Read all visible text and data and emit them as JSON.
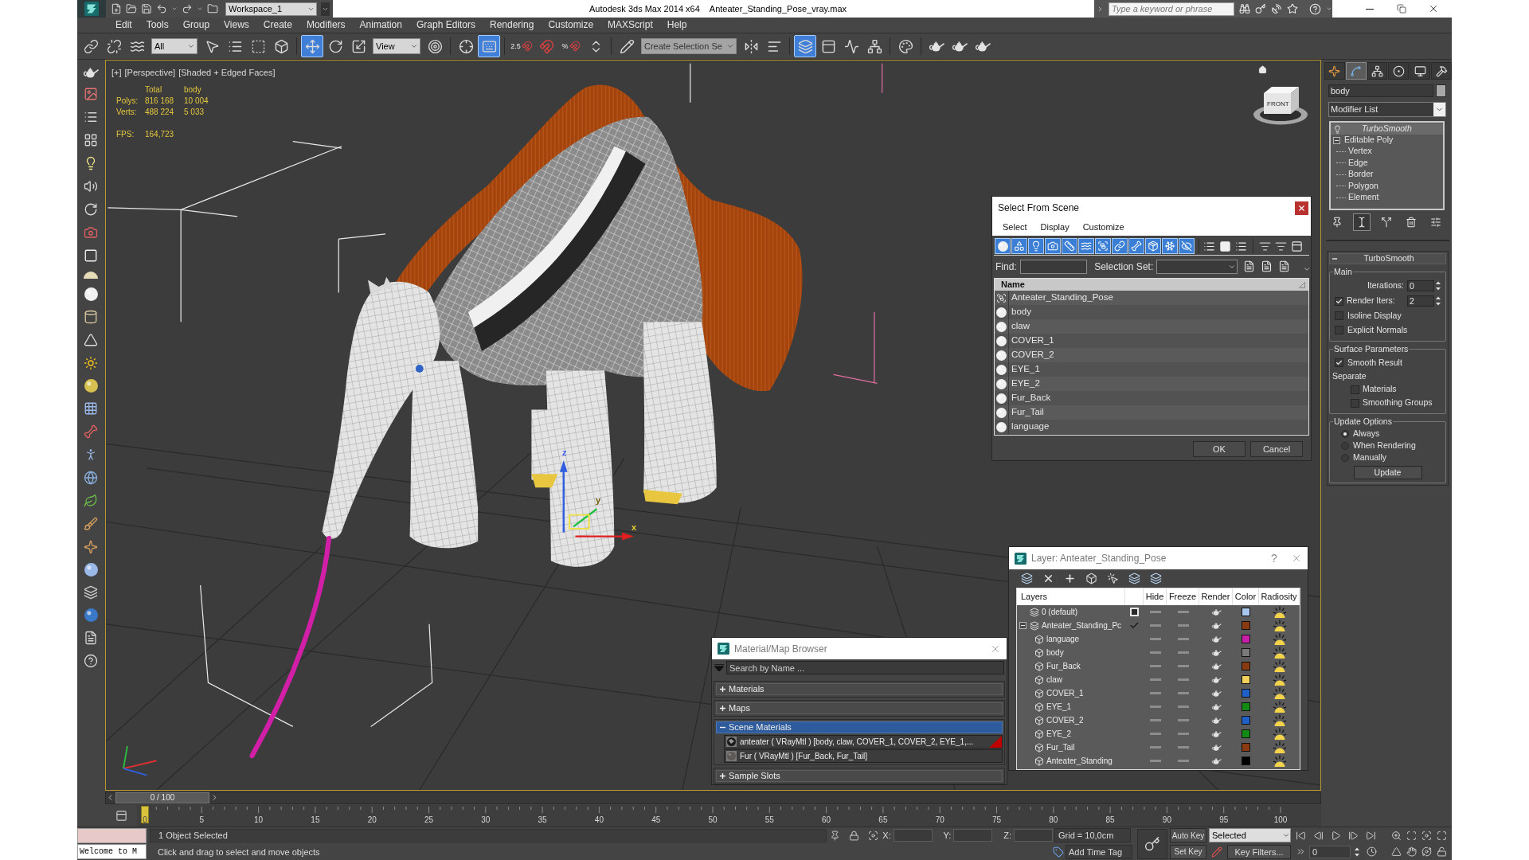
{
  "title_bar": {
    "workspace": "Workspace_1",
    "app_title": "Autodesk 3ds Max 2014 x64",
    "file_name": "Anteater_Standing_Pose_vray.max",
    "search": {
      "placeholder": "Type a keyword or phrase"
    }
  },
  "menu": [
    "Edit",
    "Tools",
    "Group",
    "Views",
    "Create",
    "Modifiers",
    "Animation",
    "Graph Editors",
    "Rendering",
    "Customize",
    "MAXScript",
    "Help"
  ],
  "main_toolbar": [
    {
      "kind": "link",
      "active": false
    },
    {
      "kind": "unlink",
      "active": false
    },
    {
      "kind": "bind",
      "active": false
    },
    {
      "kind": "filter",
      "value": "All"
    },
    {
      "kind": "select",
      "active": false
    },
    {
      "kind": "select_by_name",
      "active": false
    },
    {
      "kind": "region",
      "active": false
    },
    {
      "kind": "crossing",
      "active": false
    },
    {
      "kind": "move",
      "active": true
    },
    {
      "kind": "rotate",
      "active": false
    },
    {
      "kind": "scale",
      "active": false
    },
    {
      "kind": "coordinates",
      "value": "View"
    },
    {
      "kind": "pivot",
      "active": false
    },
    {
      "kind": "manipulate",
      "active": false
    },
    {
      "kind": "shortcut_override",
      "active": true
    },
    {
      "kind": "snap",
      "active": false,
      "label": "2.5"
    },
    {
      "kind": "angle_snap",
      "active": false
    },
    {
      "kind": "percent_snap",
      "active": false,
      "label": "%"
    },
    {
      "kind": "spinner_snap",
      "active": false
    },
    {
      "kind": "named_sets",
      "active": false
    },
    {
      "kind": "selection_sets",
      "value": "Create Selection Se"
    },
    {
      "kind": "mirror",
      "active": false
    },
    {
      "kind": "align",
      "active": false
    },
    {
      "kind": "layers",
      "active": true
    },
    {
      "kind": "ribbon",
      "active": false
    },
    {
      "kind": "curve_editor",
      "active": false
    },
    {
      "kind": "schematic",
      "active": false
    },
    {
      "kind": "material_editor",
      "active": false
    },
    {
      "kind": "render_setup",
      "active": false
    },
    {
      "kind": "frame_window",
      "active": false
    },
    {
      "kind": "render",
      "active": false
    }
  ],
  "viewport": {
    "menus": [
      "[+]",
      "[Perspective]",
      "[Shaded + Edged Faces]"
    ],
    "stats": {
      "columns": [
        "Total",
        "body"
      ],
      "rows": [
        {
          "label": "Polys:",
          "values": [
            "816 168",
            "10 004"
          ]
        },
        {
          "label": "Verts:",
          "values": [
            "488 224",
            "5 033"
          ]
        }
      ],
      "fps_label": "FPS:",
      "fps": "164,723"
    },
    "view_cube": "FRONT",
    "gizmo_labels": [
      "z",
      "y",
      "x"
    ]
  },
  "select_from_scene": {
    "title": "Select From Scene",
    "menu": [
      "Select",
      "Display",
      "Customize"
    ],
    "filters": [
      {
        "kind": "geometry",
        "on": true
      },
      {
        "kind": "shapes",
        "on": true
      },
      {
        "kind": "lights",
        "on": true
      },
      {
        "kind": "cameras",
        "on": true
      },
      {
        "kind": "helpers",
        "on": true
      },
      {
        "kind": "space_warps",
        "on": true
      },
      {
        "kind": "groups",
        "on": true
      },
      {
        "kind": "xrefs",
        "on": true
      },
      {
        "kind": "bones",
        "on": true
      },
      {
        "kind": "containers",
        "on": true
      },
      {
        "kind": "frozen",
        "on": true
      },
      {
        "kind": "hidden",
        "on": true
      }
    ],
    "find_label": "Find:",
    "selection_set_label": "Selection Set:",
    "column": "Name",
    "rows": [
      {
        "name": "Anteater_Standing_Pose",
        "kind": "group",
        "selected": false
      },
      {
        "name": "body",
        "kind": "geometry",
        "selected": false
      },
      {
        "name": "claw",
        "kind": "geometry",
        "selected": false
      },
      {
        "name": "COVER_1",
        "kind": "geometry",
        "selected": false
      },
      {
        "name": "COVER_2",
        "kind": "geometry",
        "selected": false
      },
      {
        "name": "EYE_1",
        "kind": "geometry",
        "selected": false
      },
      {
        "name": "EYE_2",
        "kind": "geometry",
        "selected": false
      },
      {
        "name": "Fur_Back",
        "kind": "geometry",
        "selected": false
      },
      {
        "name": "Fur_Tail",
        "kind": "geometry",
        "selected": false
      },
      {
        "name": "language",
        "kind": "geometry",
        "selected": false
      }
    ],
    "buttons": [
      "OK",
      "Cancel"
    ]
  },
  "layer_manager": {
    "title": "Layer: Anteater_Standing_Pose",
    "help": "?",
    "columns": [
      "Layers",
      "Hide",
      "Freeze",
      "Render",
      "Color",
      "Radiosity"
    ],
    "layers": [
      {
        "name": "0 (default)",
        "current": false,
        "expanded": false,
        "hidden": false,
        "frozen": false,
        "renderable": true,
        "radiosity": true,
        "color": "#a9c6ec"
      },
      {
        "name": "Anteater_Standing_Pc",
        "current": true,
        "expanded": true,
        "hidden": false,
        "frozen": false,
        "renderable": true,
        "radiosity": true,
        "color": "#8a3a10",
        "children": [
          {
            "name": "language",
            "hidden": false,
            "frozen": false,
            "renderable": true,
            "radiosity": true,
            "color": "#c81eaa"
          },
          {
            "name": "body",
            "hidden": false,
            "frozen": false,
            "renderable": true,
            "radiosity": true,
            "color": "#7a7a7a"
          },
          {
            "name": "Fur_Back",
            "hidden": false,
            "frozen": false,
            "renderable": true,
            "radiosity": true,
            "color": "#8a3a10"
          },
          {
            "name": "claw",
            "hidden": false,
            "frozen": false,
            "renderable": true,
            "radiosity": true,
            "color": "#f2d15a"
          },
          {
            "name": "COVER_1",
            "hidden": false,
            "frozen": false,
            "renderable": true,
            "radiosity": true,
            "color": "#1f5fc8"
          },
          {
            "name": "EYE_1",
            "hidden": false,
            "frozen": false,
            "renderable": true,
            "radiosity": true,
            "color": "#138a13"
          },
          {
            "name": "COVER_2",
            "hidden": false,
            "frozen": false,
            "renderable": true,
            "radiosity": true,
            "color": "#1f5fc8"
          },
          {
            "name": "EYE_2",
            "hidden": false,
            "frozen": false,
            "renderable": true,
            "radiosity": true,
            "color": "#138a13"
          },
          {
            "name": "Fur_Tail",
            "hidden": false,
            "frozen": false,
            "renderable": true,
            "radiosity": true,
            "color": "#8a3a10"
          },
          {
            "name": "Anteater_Standing",
            "hidden": false,
            "frozen": false,
            "renderable": true,
            "radiosity": true,
            "color": "#000000"
          }
        ]
      }
    ]
  },
  "material_browser": {
    "title": "Material/Map Browser",
    "search": {
      "placeholder": "Search by Name ..."
    },
    "groups": [
      {
        "label": "Materials",
        "expanded": false,
        "selected": false
      },
      {
        "label": "Maps",
        "expanded": false,
        "selected": false
      },
      {
        "label": "Scene Materials",
        "expanded": true,
        "selected": true,
        "items": [
          {
            "text": "anteater ( VRayMtl ) [body, claw, COVER_1, COVER_2, EYE_1,...",
            "kind": "textured",
            "flagged": true
          },
          {
            "text": "Fur ( VRayMtl ) [Fur_Back, Fur_Tail]",
            "kind": "plain",
            "flagged": false
          }
        ]
      },
      {
        "label": "Sample Slots",
        "expanded": false,
        "selected": false
      }
    ]
  },
  "command_panel": {
    "tabs": [
      {
        "kind": "create",
        "selected": false
      },
      {
        "kind": "modify",
        "selected": true
      },
      {
        "kind": "hierarchy",
        "selected": false
      },
      {
        "kind": "motion",
        "selected": false
      },
      {
        "kind": "display",
        "selected": false
      },
      {
        "kind": "utilities",
        "selected": false
      }
    ],
    "object_name": "body",
    "modifier_list": "Modifier List",
    "stack": [
      {
        "name": "TurboSmooth",
        "selected": true,
        "viewport_off": true,
        "expanded": false
      },
      {
        "name": "Editable Poly",
        "selected": false,
        "viewport_off": false,
        "expanded": true,
        "children": [
          {
            "name": "Vertex",
            "selected": false
          },
          {
            "name": "Edge",
            "selected": false
          },
          {
            "name": "Border",
            "selected": false
          },
          {
            "name": "Polygon",
            "selected": false
          },
          {
            "name": "Element",
            "selected": false
          }
        ]
      }
    ],
    "stack_tools": [
      {
        "kind": "pin",
        "active": false
      },
      {
        "kind": "end_result",
        "active": true
      },
      {
        "kind": "make_unique",
        "active": false
      },
      {
        "kind": "remove",
        "active": false
      },
      {
        "kind": "configure",
        "active": false
      }
    ],
    "rollout": {
      "title": "TurboSmooth",
      "expanded": true,
      "groups": [
        {
          "label": "Main",
          "controls": [
            {
              "kind": "spinner",
              "label": "Iterations:",
              "value": "0"
            },
            {
              "kind": "checked_spinner",
              "label": "Render Iters:",
              "checked": true,
              "value": "2"
            },
            {
              "kind": "checkbox",
              "label": "Isoline Display",
              "checked": false
            },
            {
              "kind": "checkbox",
              "label": "Explicit Normals",
              "checked": false
            }
          ]
        },
        {
          "label": "Surface Parameters",
          "controls": [
            {
              "kind": "checkbox",
              "label": "Smooth Result",
              "checked": true
            },
            {
              "kind": "text",
              "label": "Separate"
            },
            {
              "kind": "subcheckbox",
              "label": "Materials",
              "checked": false
            },
            {
              "kind": "subcheckbox",
              "label": "Smoothing Groups",
              "checked": false
            }
          ]
        },
        {
          "label": "Update Options",
          "controls": [
            {
              "kind": "radio",
              "label": "Always",
              "selected": true
            },
            {
              "kind": "radio",
              "label": "When Rendering",
              "selected": false
            },
            {
              "kind": "radio",
              "label": "Manually",
              "selected": false
            },
            {
              "kind": "button",
              "label": "Update"
            }
          ]
        }
      ]
    }
  },
  "timeline": {
    "frame": "0 / 100",
    "level": 0,
    "ticks": [
      "0",
      "5",
      "10",
      "15",
      "20",
      "25",
      "30",
      "35",
      "40",
      "45",
      "50",
      "55",
      "60",
      "65",
      "70",
      "75",
      "80",
      "85",
      "90",
      "95",
      "100"
    ]
  },
  "status_bar": {
    "listener_output": "Welcome to M",
    "selection": "1 Object Selected",
    "prompt": "Click and drag to select and move objects",
    "coordinates": [
      {
        "label": "X:"
      },
      {
        "label": "Y:"
      },
      {
        "label": "Z:"
      }
    ],
    "grid": "Grid = 10,0cm",
    "time_tag": "Add Time Tag",
    "auto_key": {
      "label": "Auto Key",
      "on": false
    },
    "key_mode": "Selected",
    "set_key": "Set Key",
    "key_filters": "Key Filters...",
    "frame": "0"
  }
}
